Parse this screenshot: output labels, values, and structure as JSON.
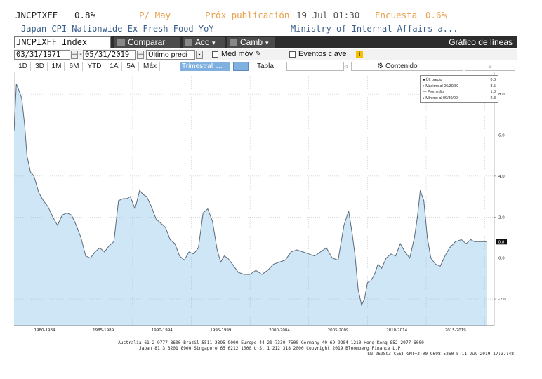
{
  "header": {
    "ticker": "JNCPIXFF",
    "last_value": "0.8%",
    "period": "P/ May",
    "next_release": "Próx publicación",
    "next_release_date": "19 Jul 01:30",
    "survey_label": "Encuesta",
    "survey_value": "0.6%",
    "description": "Japan CPI Nationwide Ex Fresh Food YoY",
    "source": "Ministry of Internal Affairs a..."
  },
  "toolbar": {
    "index_label": "JNCPIXFF Index",
    "compare_label": "Comparar",
    "actions_label": "Acc",
    "change_label": "Camb",
    "chart_type_label": "Gráfico de líneas"
  },
  "controls": {
    "start_date": "03/31/1971",
    "end_date": "05/31/2019",
    "price_select": "Último preci",
    "moving_avg_label": "Med móv",
    "events_label": "Eventos clave",
    "events_badge": "i"
  },
  "periods": {
    "buttons": [
      "1D",
      "3D",
      "1M",
      "6M",
      "YTD",
      "1A",
      "5A",
      "Máx"
    ],
    "frequency": "Trimestral",
    "table_label": "Tabla",
    "content_label": "Contenido"
  },
  "legend": {
    "rows": [
      {
        "label": "Últ precio",
        "value": "0.8"
      },
      {
        "label": "Máximo al 06/30/80",
        "value": "8.5"
      },
      {
        "label": "Promedio",
        "value": "1.0"
      },
      {
        "label": "Mínimo al 09/30/09",
        "value": "-2.3"
      }
    ]
  },
  "colors": {
    "fill": "#cfe6f7",
    "line": "#5a6a7a",
    "toolbar_bg": "#2d2d2d",
    "orange": "#e8a04a",
    "ticker": "#222222",
    "description": "#3b5f8c",
    "selected_period": "#7fb0e0"
  },
  "chart_data": {
    "type": "area",
    "title": "Japan CPI Nationwide Ex Fresh Food YoY",
    "xlabel": "",
    "ylabel": "",
    "ylim": [
      -3.3,
      9.1
    ],
    "xlim": [
      1979.9,
      2020.8
    ],
    "y_ticks": [
      8.0,
      6.0,
      4.0,
      2.0,
      0.0,
      -2.0
    ],
    "y_tick_labels": [
      "8.0",
      "6.0",
      "4.0",
      "2.0",
      "0.0",
      "-2.0"
    ],
    "x_tick_labels": [
      "1980-1984",
      "1985-1989",
      "1990-1994",
      "1995-1999",
      "2000-2004",
      "2005-2009",
      "2010-2014",
      "2015-2019"
    ],
    "last_value_label": "0.8",
    "grid": true,
    "x": [
      1979.9,
      1980.1,
      1980.3,
      1980.55,
      1980.8,
      1981.0,
      1981.3,
      1981.6,
      1982.0,
      1982.4,
      1982.8,
      1983.2,
      1983.6,
      1984.0,
      1984.4,
      1984.8,
      1985.2,
      1985.6,
      1986.0,
      1986.4,
      1986.8,
      1987.2,
      1987.6,
      1988.0,
      1988.4,
      1988.8,
      1989.2,
      1989.5,
      1989.8,
      1990.2,
      1990.6,
      1990.9,
      1991.2,
      1991.6,
      1992.0,
      1992.4,
      1992.8,
      1993.2,
      1993.6,
      1994.0,
      1994.4,
      1994.8,
      1995.2,
      1995.6,
      1996.0,
      1996.4,
      1996.8,
      1997.2,
      1997.5,
      1997.8,
      1998.1,
      1998.5,
      1999.0,
      1999.5,
      2000.0,
      2000.5,
      2001.0,
      2001.5,
      2002.0,
      2002.5,
      2003.0,
      2003.5,
      2004.0,
      2004.5,
      2005.0,
      2005.5,
      2006.0,
      2006.5,
      2007.0,
      2007.5,
      2008.0,
      2008.4,
      2008.7,
      2008.95,
      2009.2,
      2009.5,
      2009.75,
      2010.0,
      2010.3,
      2010.6,
      2010.9,
      2011.2,
      2011.6,
      2012.0,
      2012.4,
      2012.8,
      2013.2,
      2013.6,
      2014.0,
      2014.25,
      2014.5,
      2014.8,
      2015.1,
      2015.4,
      2015.8,
      2016.2,
      2016.6,
      2017.0,
      2017.5,
      2018.0,
      2018.4,
      2018.8,
      2019.1,
      2019.4,
      2020.2
    ],
    "values": [
      6.2,
      8.5,
      8.2,
      7.8,
      6.5,
      5.0,
      4.2,
      4.0,
      3.2,
      2.8,
      2.5,
      2.0,
      1.6,
      2.1,
      2.2,
      2.1,
      1.6,
      1.0,
      0.1,
      0.0,
      0.3,
      0.5,
      0.3,
      0.6,
      0.8,
      2.8,
      2.9,
      2.9,
      3.0,
      2.4,
      3.3,
      3.1,
      3.0,
      2.5,
      1.9,
      1.7,
      1.5,
      0.9,
      0.7,
      0.1,
      -0.1,
      0.3,
      0.2,
      0.5,
      2.2,
      2.4,
      1.8,
      0.4,
      -0.2,
      0.1,
      0.0,
      -0.3,
      -0.7,
      -0.8,
      -0.8,
      -0.6,
      -0.8,
      -0.6,
      -0.3,
      -0.2,
      -0.1,
      0.3,
      0.4,
      0.3,
      0.2,
      0.1,
      0.3,
      0.5,
      0.0,
      -0.1,
      1.6,
      2.3,
      1.2,
      0.1,
      -1.5,
      -2.3,
      -2.0,
      -1.2,
      -1.1,
      -0.8,
      -0.3,
      -0.5,
      0.0,
      0.2,
      0.1,
      0.7,
      0.3,
      0.0,
      1.0,
      2.0,
      3.3,
      2.8,
      1.0,
      0.0,
      -0.3,
      -0.4,
      0.1,
      0.5,
      0.8,
      0.9,
      0.7,
      0.9,
      0.8,
      0.8,
      0.8
    ]
  },
  "footer": {
    "line1": "Australia 61 2 9777 8600 Brazil 5511 2395 9000 Europe 44 20 7330 7500 Germany 49 69 9204 1210 Hong Kong 852 2977 6000",
    "line2": "Japan 81 3 3201 8900        Singapore 65 6212 1000        U.S. 1 212 318 2000        Copyright 2019 Bloomberg Finance L.P.",
    "line3": "SN 269893 CEST GMT+2:00 G698-5260-5 11-Jul-2019 17:37:48"
  }
}
